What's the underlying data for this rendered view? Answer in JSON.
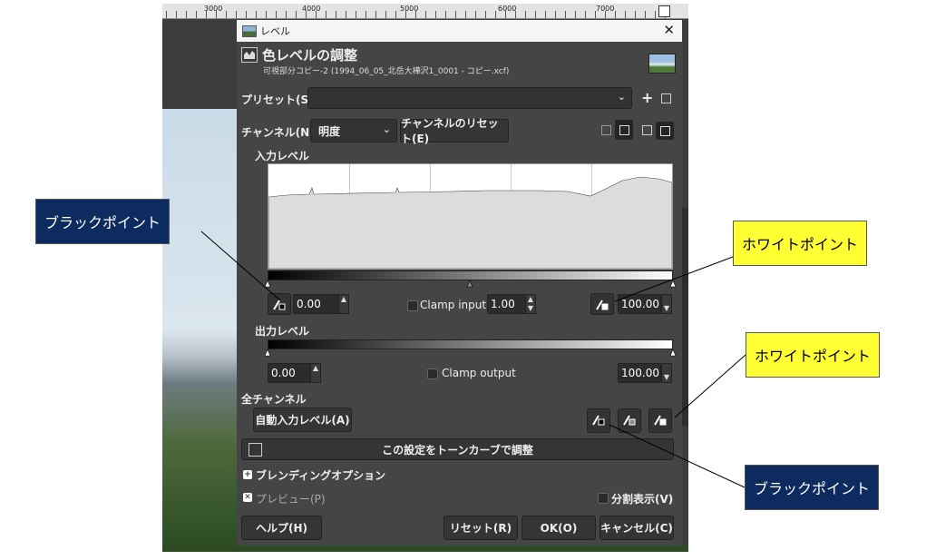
{
  "ruler": {
    "labels": [
      "3000",
      "4000",
      "5000",
      "6000",
      "7000"
    ]
  },
  "dialog": {
    "window_title": "レベル",
    "header_title": "色レベルの調整",
    "header_subtitle": "可視部分コピー-2 (1994_06_05_北岳大樺沢1_0001 - コピー.xcf)",
    "preset_label": "プリセット(S):",
    "preset_value": "",
    "add_preset_glyph": "+",
    "channel_label": "チャンネル(N):",
    "channel_value": "明度",
    "channel_reset_button": "チャンネルのリセット(E)",
    "input_levels_label": "入力レベル",
    "input_black_value": "0.00",
    "clamp_input_label": "Clamp input",
    "gamma_value": "1.00",
    "input_white_value": "100.00",
    "output_levels_label": "出力レベル",
    "output_black_value": "0.00",
    "clamp_output_label": "Clamp output",
    "output_white_value": "100.00",
    "all_channels_label": "全チャンネル",
    "auto_input_button": "自動入力レベル(A)",
    "curves_button": "この設定をトーンカーブで調整",
    "blending_options_label": "ブレンディングオプション",
    "preview_label": "プレビュー(P)",
    "split_view_label": "分割表示(V)",
    "help_button": "ヘルプ(H)",
    "reset_button": "リセット(R)",
    "ok_button": "OK(O)",
    "cancel_button": "キャンセル(C)"
  },
  "callouts": {
    "black_point_left": "ブラックポイント",
    "white_point_top": "ホワイトポイント",
    "white_point_right": "ホワイトポイント",
    "black_point_bottom": "ブラックポイント"
  },
  "colors": {
    "dialog_bg": "#454545",
    "callout_blue": "#0d2b5e",
    "callout_yellow": "#ffff33"
  }
}
